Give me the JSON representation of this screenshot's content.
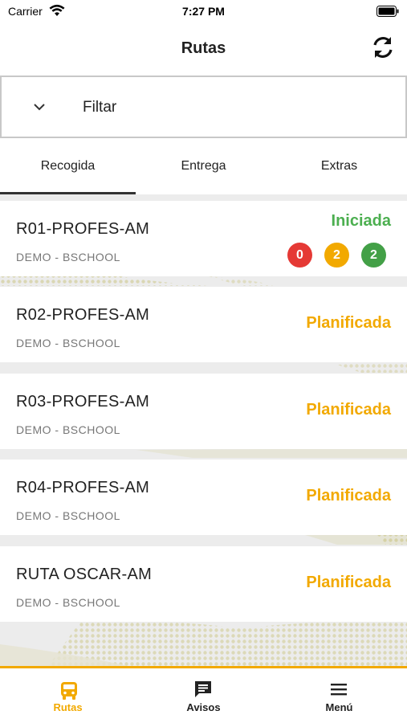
{
  "status_bar": {
    "carrier": "Carrier",
    "time": "7:27 PM"
  },
  "nav": {
    "title": "Rutas",
    "refresh_icon": "refresh-icon"
  },
  "filter": {
    "label": "Filtar",
    "icon": "chevron-down-icon"
  },
  "tabs": [
    {
      "label": "Recogida",
      "active": true
    },
    {
      "label": "Entrega",
      "active": false
    },
    {
      "label": "Extras",
      "active": false
    }
  ],
  "routes": [
    {
      "name": "R01-PROFES-AM",
      "client": "DEMO - BSCHOOL",
      "status": "Iniciada",
      "status_color": "#4caf50",
      "counts": [
        {
          "value": "0",
          "color": "#e53935"
        },
        {
          "value": "2",
          "color": "#f2a900"
        },
        {
          "value": "2",
          "color": "#43a047"
        }
      ]
    },
    {
      "name": "R02-PROFES-AM",
      "client": "DEMO - BSCHOOL",
      "status": "Planificada",
      "status_color": "#f2a900",
      "counts": []
    },
    {
      "name": "R03-PROFES-AM",
      "client": "DEMO - BSCHOOL",
      "status": "Planificada",
      "status_color": "#f2a900",
      "counts": []
    },
    {
      "name": "R04-PROFES-AM",
      "client": "DEMO - BSCHOOL",
      "status": "Planificada",
      "status_color": "#f2a900",
      "counts": []
    },
    {
      "name": "RUTA OSCAR-AM",
      "client": "DEMO - BSCHOOL",
      "status": "Planificada",
      "status_color": "#f2a900",
      "counts": []
    }
  ],
  "tab_bar": {
    "accent": "#f2a900",
    "items": [
      {
        "label": "Rutas",
        "icon": "bus-icon",
        "active": true
      },
      {
        "label": "Avisos",
        "icon": "chat-icon",
        "active": false
      },
      {
        "label": "Menú",
        "icon": "menu-icon",
        "active": false
      }
    ]
  }
}
